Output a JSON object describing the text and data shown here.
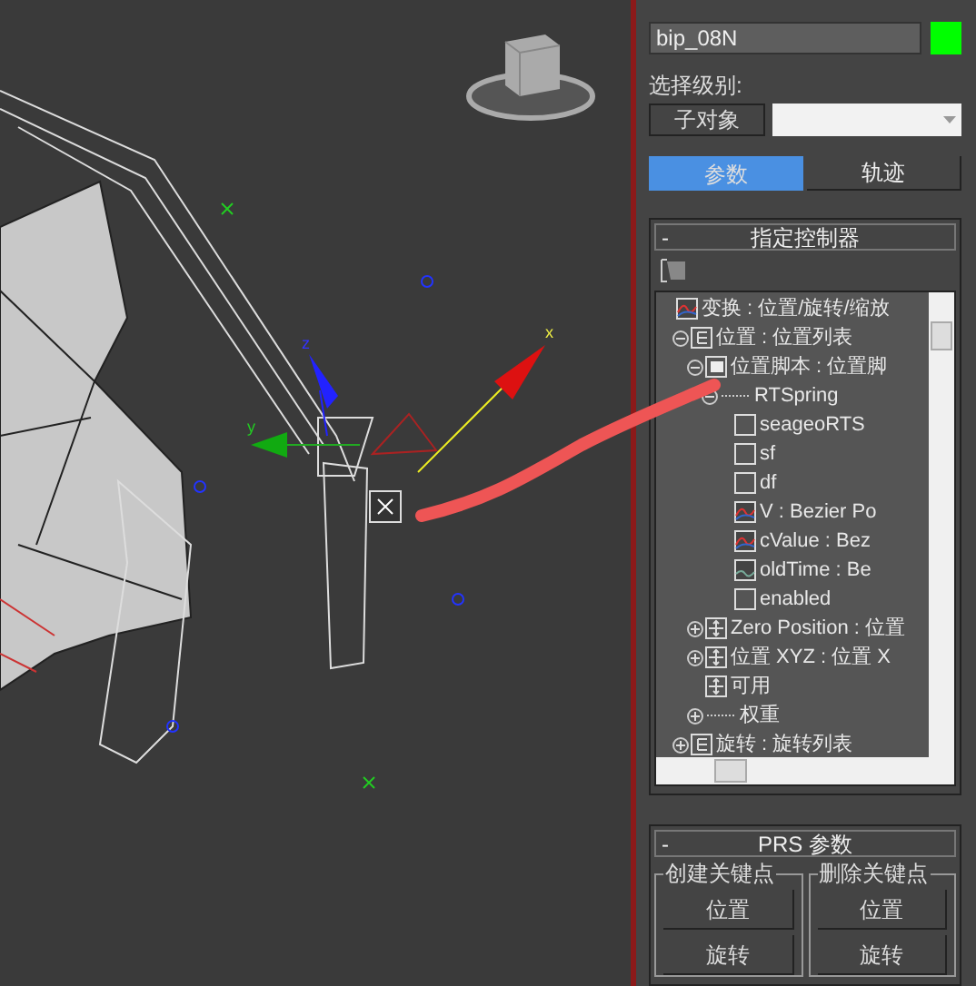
{
  "viewport": {
    "axis_labels": [
      "x",
      "y",
      "z"
    ]
  },
  "panel": {
    "object_name": "bip_08N",
    "selection_level_label": "选择级别:",
    "sub_object_button": "子对象",
    "tabs": [
      {
        "label": "参数",
        "selected": true
      },
      {
        "label": "轨迹",
        "selected": false
      }
    ],
    "assign_controller": {
      "collapse_sign": "-",
      "title": "指定控制器",
      "tree": [
        {
          "label": "变换 : 位置/旋转/缩放",
          "kind": "curve",
          "children": [
            {
              "label": "位置 : 位置列表",
              "kind": "list",
              "expanded": true,
              "children": [
                {
                  "label": "位置脚本 : 位置脚",
                  "kind": "script",
                  "expanded": true,
                  "children": [
                    {
                      "label": "RTSpring",
                      "kind": "plain",
                      "expanded": true,
                      "children": [
                        {
                          "label": "seageoRTS",
                          "kind": "empty"
                        },
                        {
                          "label": "sf",
                          "kind": "empty"
                        },
                        {
                          "label": "df",
                          "kind": "empty"
                        },
                        {
                          "label": "V : Bezier Po",
                          "kind": "curve"
                        },
                        {
                          "label": "cValue : Bez",
                          "kind": "curve"
                        },
                        {
                          "label": "oldTime : Be",
                          "kind": "flat"
                        },
                        {
                          "label": "enabled",
                          "kind": "empty"
                        }
                      ]
                    }
                  ]
                },
                {
                  "label": "Zero Position : 位置",
                  "kind": "move",
                  "expanded": false
                },
                {
                  "label": "位置 XYZ : 位置 X",
                  "kind": "move",
                  "expanded": false
                },
                {
                  "label": "可用",
                  "kind": "move"
                },
                {
                  "label": "权重",
                  "kind": "plain",
                  "expanded": false
                }
              ]
            },
            {
              "label": "旋转 : 旋转列表",
              "kind": "list",
              "expanded": false
            }
          ]
        }
      ]
    },
    "prs": {
      "collapse_sign": "-",
      "title": "PRS 参数",
      "groups": [
        {
          "title": "创建关键点",
          "buttons": [
            "位置",
            "旋转"
          ]
        },
        {
          "title": "删除关键点",
          "buttons": [
            "位置",
            "旋转"
          ]
        }
      ]
    }
  }
}
